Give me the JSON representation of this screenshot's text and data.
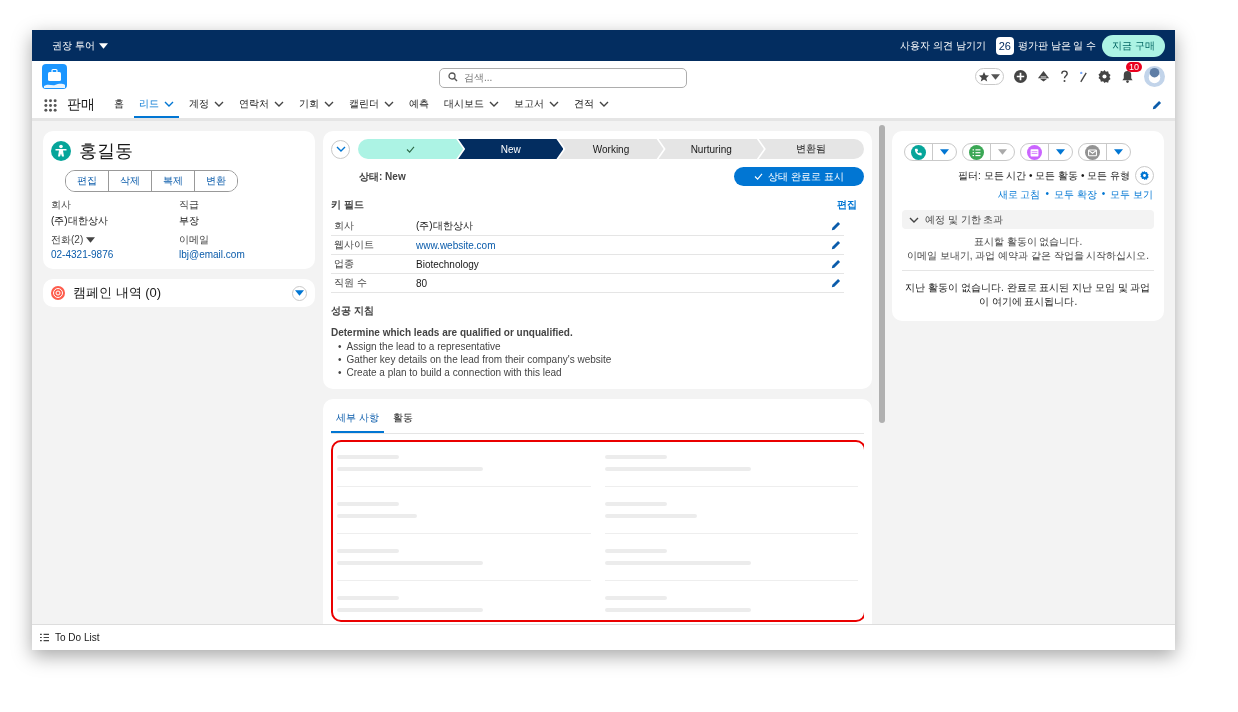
{
  "top_bar": {
    "tour": "권장 투어",
    "feedback": "사용자 의견 남기기",
    "trial_days": "26",
    "trial_label": "평가판 남은 일 수",
    "buy": "지금 구매"
  },
  "header": {
    "search": {
      "placeholder": "검색..."
    },
    "notification_count": "10"
  },
  "nav": {
    "app_name": "판매",
    "items": [
      {
        "label": "홈",
        "selected": false,
        "menu": false
      },
      {
        "label": "리드",
        "selected": true,
        "menu": true
      },
      {
        "label": "계정",
        "selected": false,
        "menu": true
      },
      {
        "label": "연락처",
        "selected": false,
        "menu": true
      },
      {
        "label": "기회",
        "selected": false,
        "menu": true
      },
      {
        "label": "캘린더",
        "selected": false,
        "menu": true
      },
      {
        "label": "예측",
        "selected": false,
        "menu": false
      },
      {
        "label": "대시보드",
        "selected": false,
        "menu": true
      },
      {
        "label": "보고서",
        "selected": false,
        "menu": true
      },
      {
        "label": "견적",
        "selected": false,
        "menu": true
      }
    ]
  },
  "record": {
    "name": "홍길동",
    "actions": [
      "편집",
      "삭제",
      "복제",
      "변환"
    ],
    "fields": [
      {
        "label": "회사",
        "value": "(주)대한상사",
        "kind": "text",
        "dropdown": false
      },
      {
        "label": "직급",
        "value": "부장",
        "kind": "text",
        "dropdown": false
      },
      {
        "label": "전화(2)",
        "value": "02-4321-9876",
        "kind": "link",
        "dropdown": true
      },
      {
        "label": "이메일",
        "value": "lbj@email.com",
        "kind": "link",
        "dropdown": false
      }
    ]
  },
  "campaign": {
    "title": "캠페인 내역 (0)"
  },
  "path": {
    "stages": [
      {
        "completed": true,
        "selected": false
      },
      {
        "completed": false,
        "selected": true,
        "label": "New"
      },
      {
        "completed": false,
        "selected": false,
        "label": "Working"
      },
      {
        "completed": false,
        "selected": false,
        "label": "Nurturing"
      },
      {
        "completed": false,
        "selected": false,
        "label": "변환됨"
      }
    ],
    "status_text": "상태: New",
    "mark_button": "상태 완료로 표시"
  },
  "key_fields": {
    "title": "키 필드",
    "edit": "편집",
    "rows": [
      {
        "label": "회사",
        "value": "(주)대한상사",
        "kind": "text"
      },
      {
        "label": "웹사이트",
        "value": "www.website.com",
        "kind": "link"
      },
      {
        "label": "업종",
        "value": "Biotechnology",
        "kind": "text"
      },
      {
        "label": "직원 수",
        "value": "80",
        "kind": "text"
      }
    ]
  },
  "guidance": {
    "title": "성공 지침",
    "heading": "Determine which leads are qualified or unqualified.",
    "bullet": "•",
    "bullets": [
      "Assign the lead to a representative",
      "Gather key details on the lead from their company's website",
      "Create a plan to build a connection with this lead"
    ]
  },
  "tabs": [
    {
      "label": "세부 사항",
      "selected": true
    },
    {
      "label": "활동",
      "selected": false
    }
  ],
  "activity": {
    "buttons": [
      {
        "kind": "call",
        "color": "#06a59a",
        "disabled": false
      },
      {
        "kind": "task",
        "color": "#3ba755",
        "disabled": true
      },
      {
        "kind": "event",
        "color": "#cb65ff",
        "disabled": false
      },
      {
        "kind": "email",
        "color": "#939393",
        "disabled": false
      }
    ],
    "filter": "필터: 모든 시간 • 모든 활동 • 모든 유형",
    "links": [
      "새로 고침",
      "모두 확장",
      "모두 보기"
    ],
    "link_separator": "•",
    "upcoming_title": "예정 및 기한 초과",
    "upcoming_empty": [
      "표시할 활동이 없습니다.",
      "이메일 보내기, 과업 예약과 같은 작업을 시작하십시오."
    ],
    "past_empty": "지난 활동이 없습니다. 완료로 표시된 지난 모임 및 과업이 여기에 표시됩니다."
  },
  "utility_bar": {
    "label": "To Do List"
  }
}
